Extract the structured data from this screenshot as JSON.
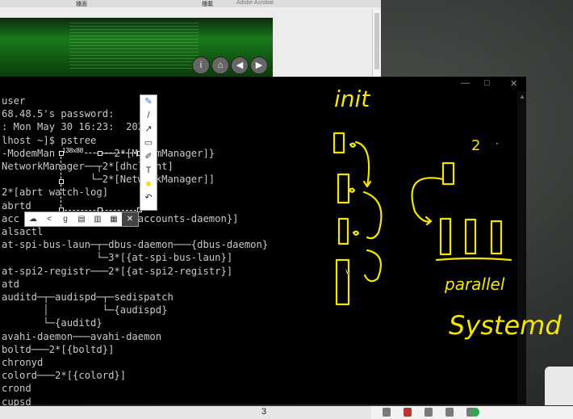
{
  "background_window": {
    "tab_labels": [
      "播面",
      "播載",
      "Adobe Acrobat"
    ],
    "nav_buttons": [
      "i",
      "⌂",
      "◀",
      "▶"
    ]
  },
  "terminal": {
    "window_controls": [
      "—",
      "□",
      "✕"
    ],
    "lines": [
      "user",
      "68.48.5's password:",
      ": Mon May 30 16:23:  2022",
      "lhost ~]$ pstree",
      "-ModemMan       ───2*[ModemManager]}",
      "NetworkManager──┬2*[dhclient]",
      "               └─2*[NetworkManager]]",
      "2*[abrt watch-log]",
      "abrtd",
      "acc                2*[{accounts-daemon}]",
      "alsactl",
      "at-spi-bus-laun─┬─dbus-daemon───{dbus-daemon}",
      "                └─3*[{at-spi-bus-laun}]",
      "at-spi2-registr───2*[{at-spi2-registr}]",
      "atd",
      "auditd─┬─audispd─┬─sedispatch",
      "       │         └─{audispd}",
      "       └─{auditd}",
      "avahi-daemon───avahi-daemon",
      "boltd───2*[{boltd}]",
      "chronyd",
      "colord───2*[{colord}]",
      "crond",
      "cupsd"
    ]
  },
  "snip": {
    "size_badge": "138x88",
    "vertical_tools": [
      "✎",
      "/",
      "↗",
      "▭",
      "✐",
      "T",
      "■",
      "↶"
    ],
    "horizontal_tools": [
      "☁",
      "<",
      "g",
      "▤",
      "▥",
      "▦"
    ],
    "close": "✕",
    "highlight_color": "#f5e400"
  },
  "handwriting": {
    "color": "#f2e600",
    "labels": [
      "init",
      "2",
      "parallel",
      "Systemd"
    ]
  },
  "status_bar": {
    "page_number": "3"
  }
}
